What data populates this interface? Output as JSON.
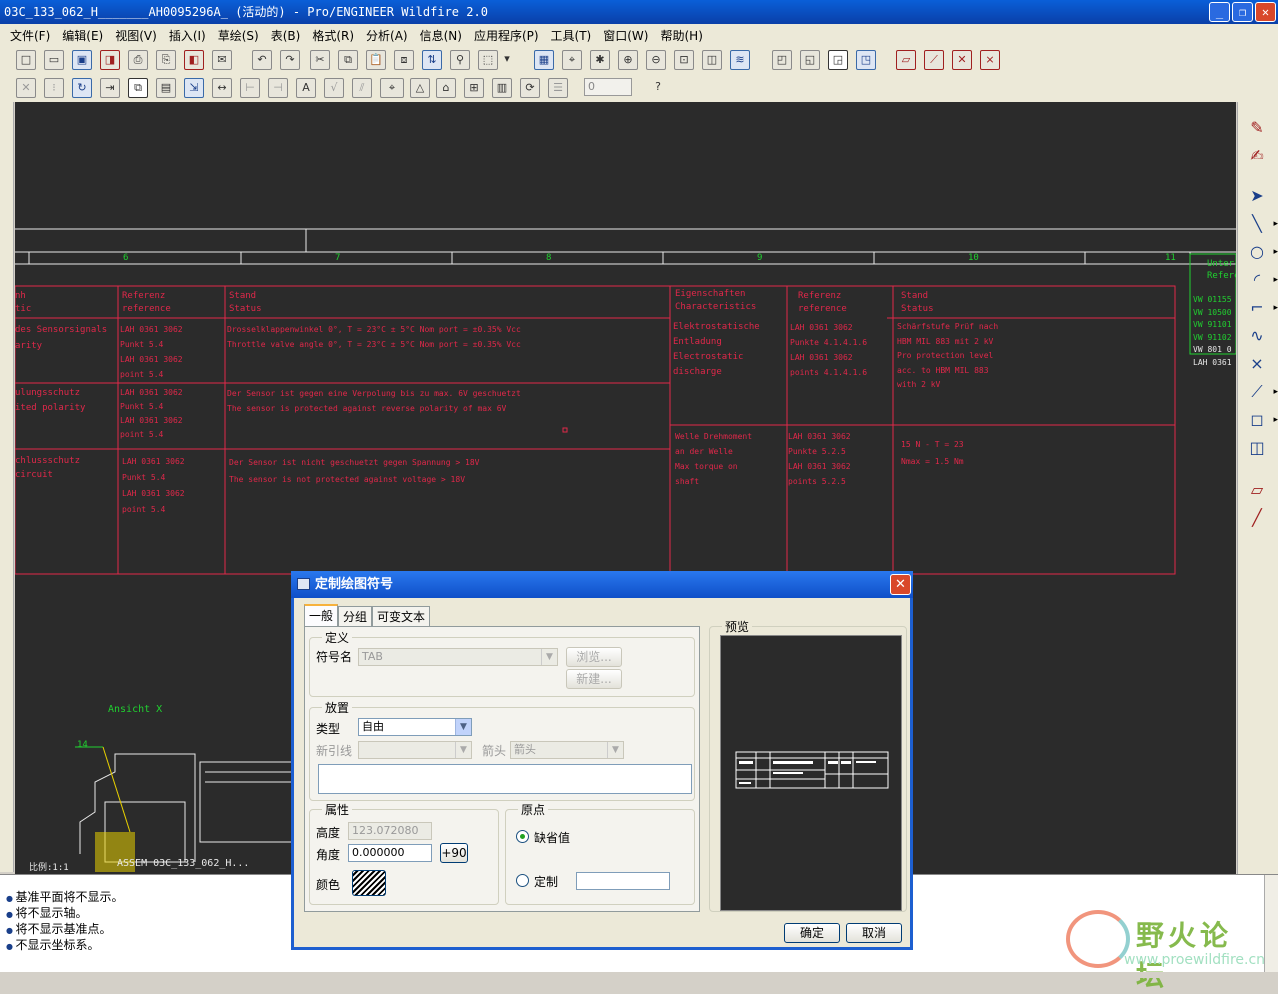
{
  "window": {
    "title": "03C_133_062_H_______AH0095296A_ (活动的) - Pro/ENGINEER Wildfire 2.0",
    "minimize": "_",
    "restore": "❐",
    "close": "✕"
  },
  "menu": [
    "文件(F)",
    "编辑(E)",
    "视图(V)",
    "插入(I)",
    "草绘(S)",
    "表(B)",
    "格式(R)",
    "分析(A)",
    "信息(N)",
    "应用程序(P)",
    "工具(T)",
    "窗口(W)",
    "帮助(H)"
  ],
  "toolbar2": {
    "spin_value": "0"
  },
  "drawing": {
    "col_numbers": [
      "6",
      "7",
      "8",
      "9",
      "10",
      "11"
    ],
    "headers": [
      {
        "l1": "nh",
        "l2": "tic"
      },
      {
        "l1": "Referenz",
        "l2": "reference"
      },
      {
        "l1": "Stand",
        "l2": "Status"
      },
      {
        "l1": "Eigenschaften",
        "l2": "Characteristics"
      },
      {
        "l1": "Referenz",
        "l2": "reference"
      },
      {
        "l1": "Stand",
        "l2": "Status"
      }
    ],
    "right_block": {
      "head1": "Unter",
      "head2": "Refere",
      "items": [
        "VW 01155",
        "VW 10500",
        "VW 91101",
        "VW 91102",
        "VW 801 0",
        "LAH 0361"
      ]
    },
    "rows": {
      "r1c1": [
        "des Sensorsignals",
        "arity"
      ],
      "r1c2": [
        "LAH 0361 3062",
        "Punkt 5.4",
        "LAH 0361 3062",
        "point 5.4"
      ],
      "r1c3": [
        "Drosselklappenwinkel 0°, T = 23°C ± 5°C    Nom port = ±0.35% Vcc",
        "Throttle valve angle 0°, T = 23°C ± 5°C    Nom port = ±0.35% Vcc"
      ],
      "r1c4": [
        "Elektrostatische",
        "Entladung",
        "Electrostatic",
        "discharge"
      ],
      "r1c5": [
        "LAH 0361 3062",
        "Punkte 4.1.4.1.6",
        "LAH 0361 3062",
        "points 4.1.4.1.6"
      ],
      "r1c6": [
        "Schärfstufe Prüf nach",
        "HBM MIL 883 mit 2 kV",
        "Pro protection level",
        "acc. to HBM MIL 883",
        "with 2 kV"
      ],
      "r2c1": [
        "ulungsschutz",
        "ited polarity"
      ],
      "r2c2": [
        "LAH 0361 3062",
        "Punkt 5.4",
        "LAH 0361 3062",
        "point 5.4"
      ],
      "r2c3": [
        "Der Sensor ist gegen eine Verpolung bis zu max. 6V geschuetzt",
        "The sensor is protected against reverse polarity of max 6V"
      ],
      "r3c1": [
        "chlussschutz",
        "circuit"
      ],
      "r3c2": [
        "LAH 0361 3062",
        "Punkt 5.4",
        "LAH 0361 3062",
        "point 5.4"
      ],
      "r3c3": [
        "Der Sensor ist nicht geschuetzt gegen Spannung > 18V",
        "The sensor is not protected against voltage > 18V"
      ],
      "r3c4": [
        "Welle Drehmoment",
        "an der Welle",
        "Max torque on",
        "shaft"
      ],
      "r3c5": [
        "LAH 0361 3062",
        "Punkte 5.2.5",
        "LAH 0361 3062",
        "points 5.2.5"
      ],
      "r3c6": [
        "15 N - T = 23",
        "Nmax = 1.5 Nm"
      ]
    },
    "view_label": "Ansicht  X",
    "balloon": "14",
    "scale_label": "比例:1:1",
    "asm_label": "ASSEM  03C_133_062_H..."
  },
  "messages": [
    "基准平面将不显示。",
    "将不显示轴。",
    "将不显示基准点。",
    "不显示坐标系。"
  ],
  "dialog": {
    "title": "定制绘图符号",
    "close": "✕",
    "tabs": [
      "一般",
      "分组",
      "可变文本"
    ],
    "definition": {
      "label": "定义",
      "symbol_name_label": "符号名",
      "symbol_name_value": "TAB",
      "browse": "浏览...",
      "new": "新建..."
    },
    "placement": {
      "label": "放置",
      "type_label": "类型",
      "type_value": "自由",
      "leader_label": "新引线",
      "arrow_label": "箭头",
      "arrow_value": "箭头"
    },
    "properties": {
      "label": "属性",
      "height_label": "高度",
      "height_value": "123.072080",
      "angle_label": "角度",
      "angle_value": "0.000000",
      "plus90": "+90",
      "color_label": "颜色"
    },
    "origin": {
      "label": "原点",
      "default": "缺省值",
      "custom": "定制"
    },
    "preview_label": "预览",
    "ok": "确定",
    "cancel": "取消"
  },
  "watermark": {
    "title": "野火论坛",
    "url": "www.proewildfire.cn"
  },
  "colors": {
    "drawing_red": "#e0284a",
    "drawing_green": "#20d030",
    "canvas": "#2b2b2b",
    "titlebar": "#0a5fd8"
  }
}
